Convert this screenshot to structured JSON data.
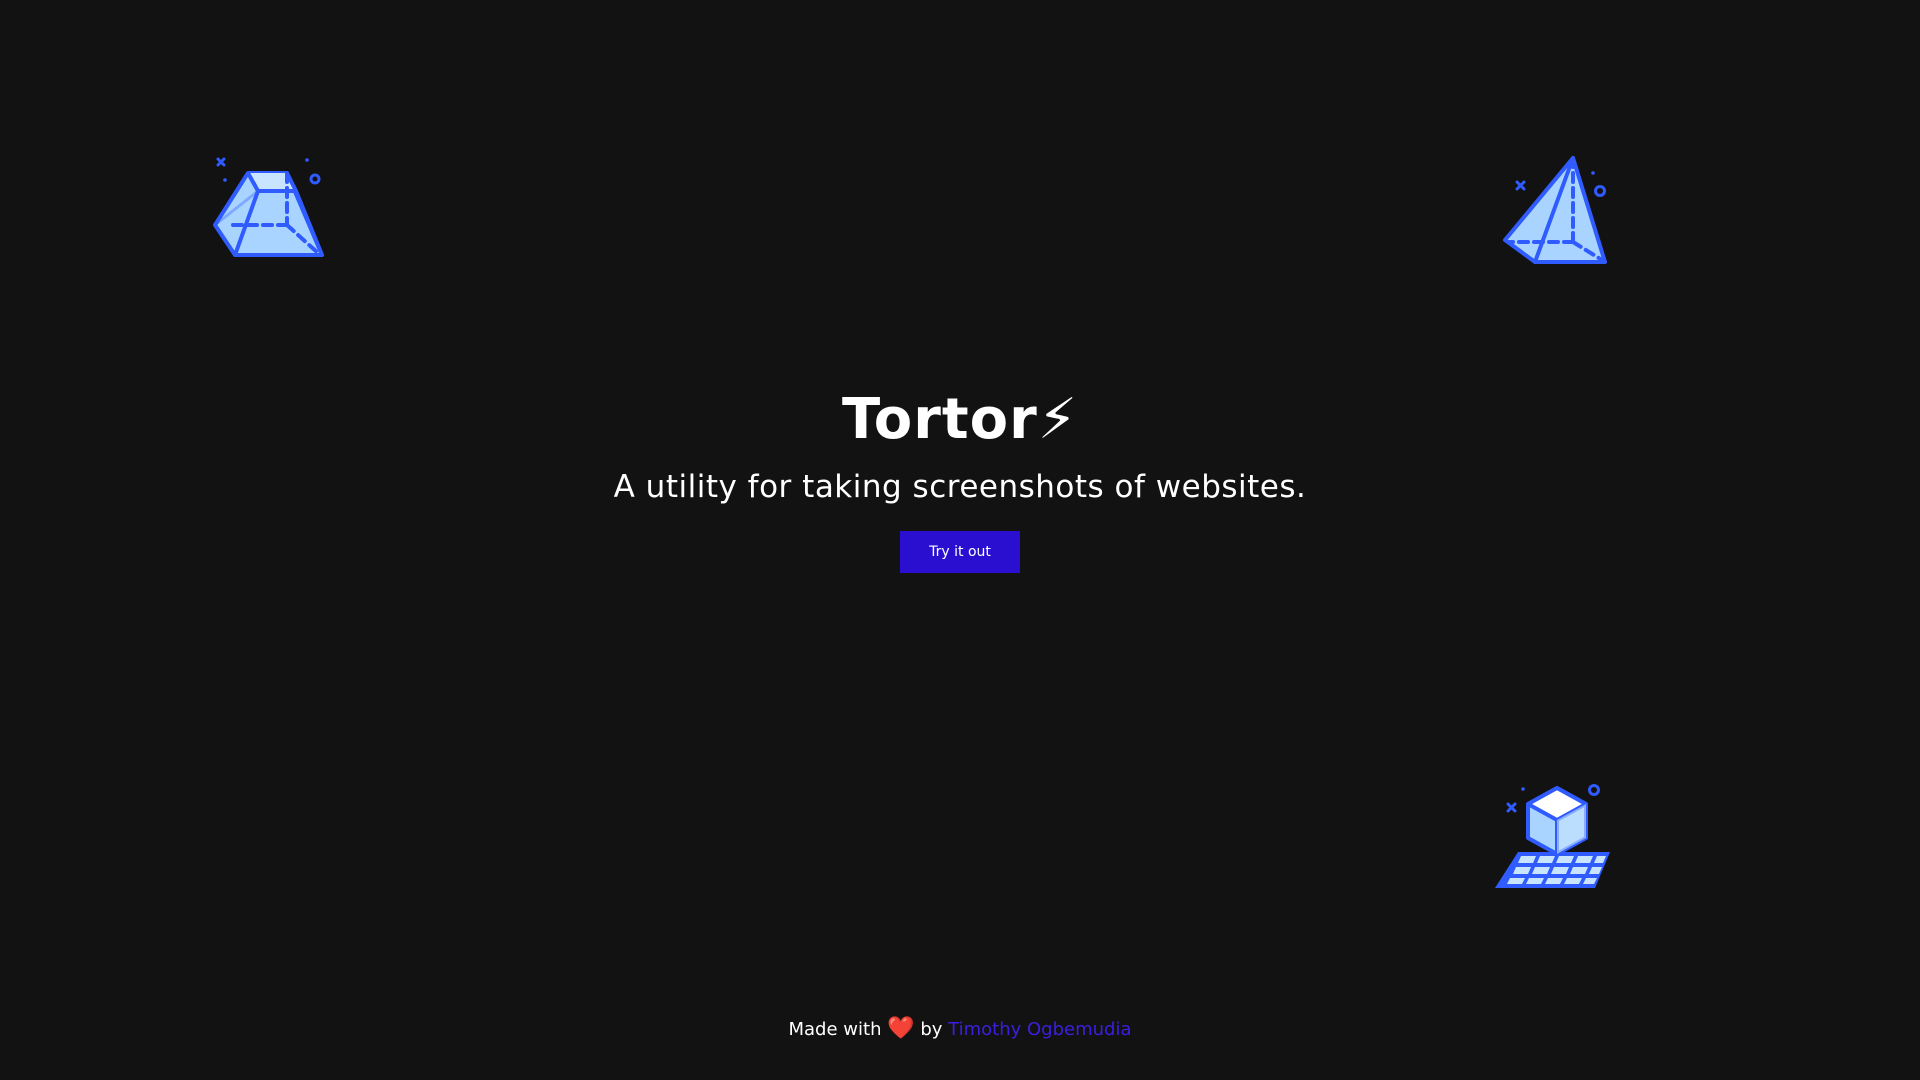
{
  "hero": {
    "title": "Tortor",
    "title_icon": "⚡",
    "subtitle": "A utility for taking screenshots of websites.",
    "cta_label": "Try it out"
  },
  "footer": {
    "prefix": "Made with",
    "heart": "❤️",
    "by": "by",
    "author": "Timothy Ogbemudia"
  },
  "colors": {
    "background": "#121212",
    "accent": "#2b0fd1",
    "illustration_stroke": "#2f5bff",
    "illustration_fill": "#a9d4ff"
  },
  "decorations": [
    "prism-illustration",
    "pyramid-illustration",
    "cube-grid-illustration"
  ]
}
